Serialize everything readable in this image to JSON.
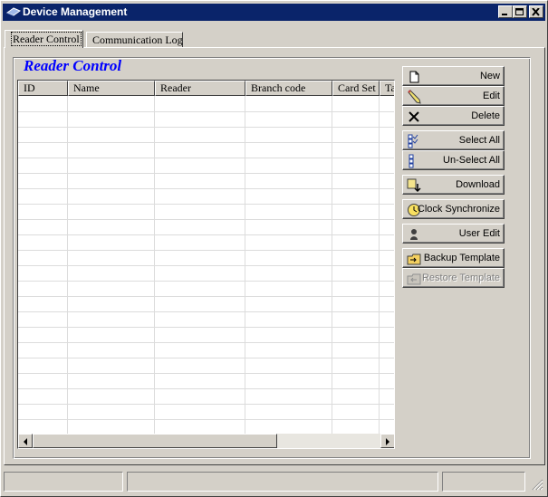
{
  "window": {
    "title": "Device Management",
    "icons": {
      "app": "device-icon",
      "minimize": "minimize-icon",
      "maximize": "maximize-icon",
      "close": "close-icon"
    }
  },
  "tabs": [
    {
      "label": "Reader Control",
      "selected": true
    },
    {
      "label": "Communication Log",
      "selected": false
    }
  ],
  "section": {
    "title": "Reader Control",
    "title_color": "#0000ff"
  },
  "grid": {
    "columns": [
      "ID",
      "Name",
      "Reader",
      "Branch code",
      "Card Set",
      "Ta"
    ],
    "rows": [],
    "icons": {
      "scroll_left": "arrow-left-icon",
      "scroll_right": "arrow-right-icon"
    }
  },
  "actions": [
    {
      "label": "New",
      "icon": "new-document-icon",
      "enabled": true
    },
    {
      "label": "Edit",
      "icon": "pencil-icon",
      "enabled": true
    },
    {
      "label": "Delete",
      "icon": "delete-x-icon",
      "enabled": true
    },
    {
      "label": "Select All",
      "icon": "checklist-icon",
      "enabled": true
    },
    {
      "label": "Un-Select All",
      "icon": "unchecked-list-icon",
      "enabled": true
    },
    {
      "label": "Download",
      "icon": "download-icon",
      "enabled": true
    },
    {
      "label": "Clock Synchronize",
      "icon": "clock-icon",
      "enabled": true
    },
    {
      "label": "User Edit",
      "icon": "user-icon",
      "enabled": true
    },
    {
      "label": "Backup Template",
      "icon": "backup-folder-icon",
      "enabled": true
    },
    {
      "label": "Restore Template",
      "icon": "restore-folder-icon",
      "enabled": false
    }
  ],
  "statusbar": {
    "panels": [
      "",
      "",
      ""
    ]
  }
}
